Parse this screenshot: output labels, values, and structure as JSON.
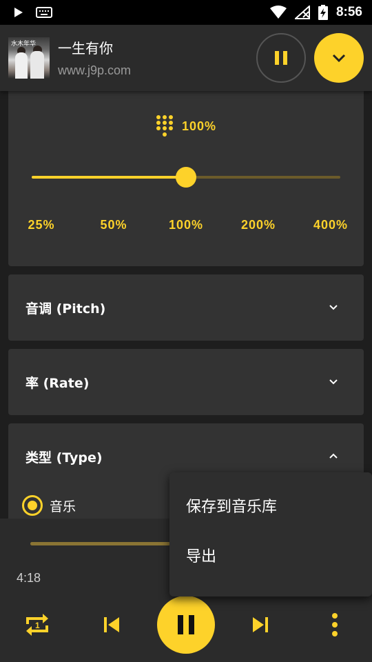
{
  "status_bar": {
    "time": "8:56"
  },
  "now_playing": {
    "title": "一生有你",
    "artist": "www.j9p.com",
    "cover_text": "水木年华"
  },
  "speed": {
    "current": "100%",
    "level_fraction": 0.5,
    "ticks": [
      "25%",
      "50%",
      "100%",
      "200%",
      "400%"
    ]
  },
  "sections": {
    "pitch": "音调 (Pitch)",
    "rate": "率 (Rate)",
    "type": "类型 (Type)"
  },
  "type_options": {
    "selected": "音乐"
  },
  "player": {
    "elapsed": "4:18",
    "progress_fraction": 0.45
  },
  "menu": {
    "items": [
      "保存到音乐库",
      "导出"
    ]
  },
  "colors": {
    "accent": "#fdd22a",
    "card": "#333333",
    "background": "#1e1e1e"
  }
}
